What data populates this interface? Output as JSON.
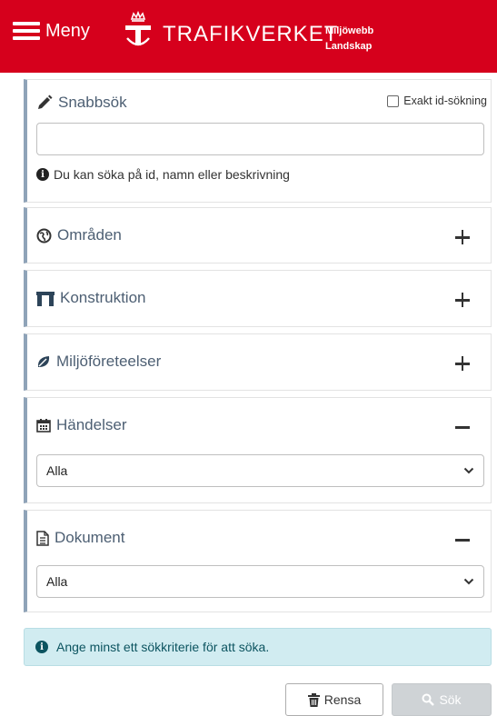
{
  "header": {
    "menu_label": "Meny",
    "brand": "TRAFIKVERKET",
    "app_line1": "Miljöwebb",
    "app_line2": "Landskap"
  },
  "quicksearch": {
    "title": "Snabbsök",
    "exact_label": "Exakt id-sökning",
    "exact_checked": false,
    "input_value": "",
    "hint": "Du kan söka på id, namn eller beskrivning"
  },
  "sections": {
    "areas": {
      "title": "Områden",
      "expanded": false
    },
    "construction": {
      "title": "Konstruktion",
      "expanded": false
    },
    "env_features": {
      "title": "Miljöföreteelser",
      "expanded": false
    },
    "events": {
      "title": "Händelser",
      "expanded": true,
      "selected": "Alla"
    },
    "documents": {
      "title": "Dokument",
      "expanded": true,
      "selected": "Alla"
    }
  },
  "alert": {
    "text": "Ange minst ett sökkriterie för att söka."
  },
  "buttons": {
    "clear": "Rensa",
    "search": "Sök"
  },
  "colors": {
    "brand_red": "#d6001c",
    "panel_accent": "#8fa3b8",
    "info_bg": "#d1ecf1"
  }
}
